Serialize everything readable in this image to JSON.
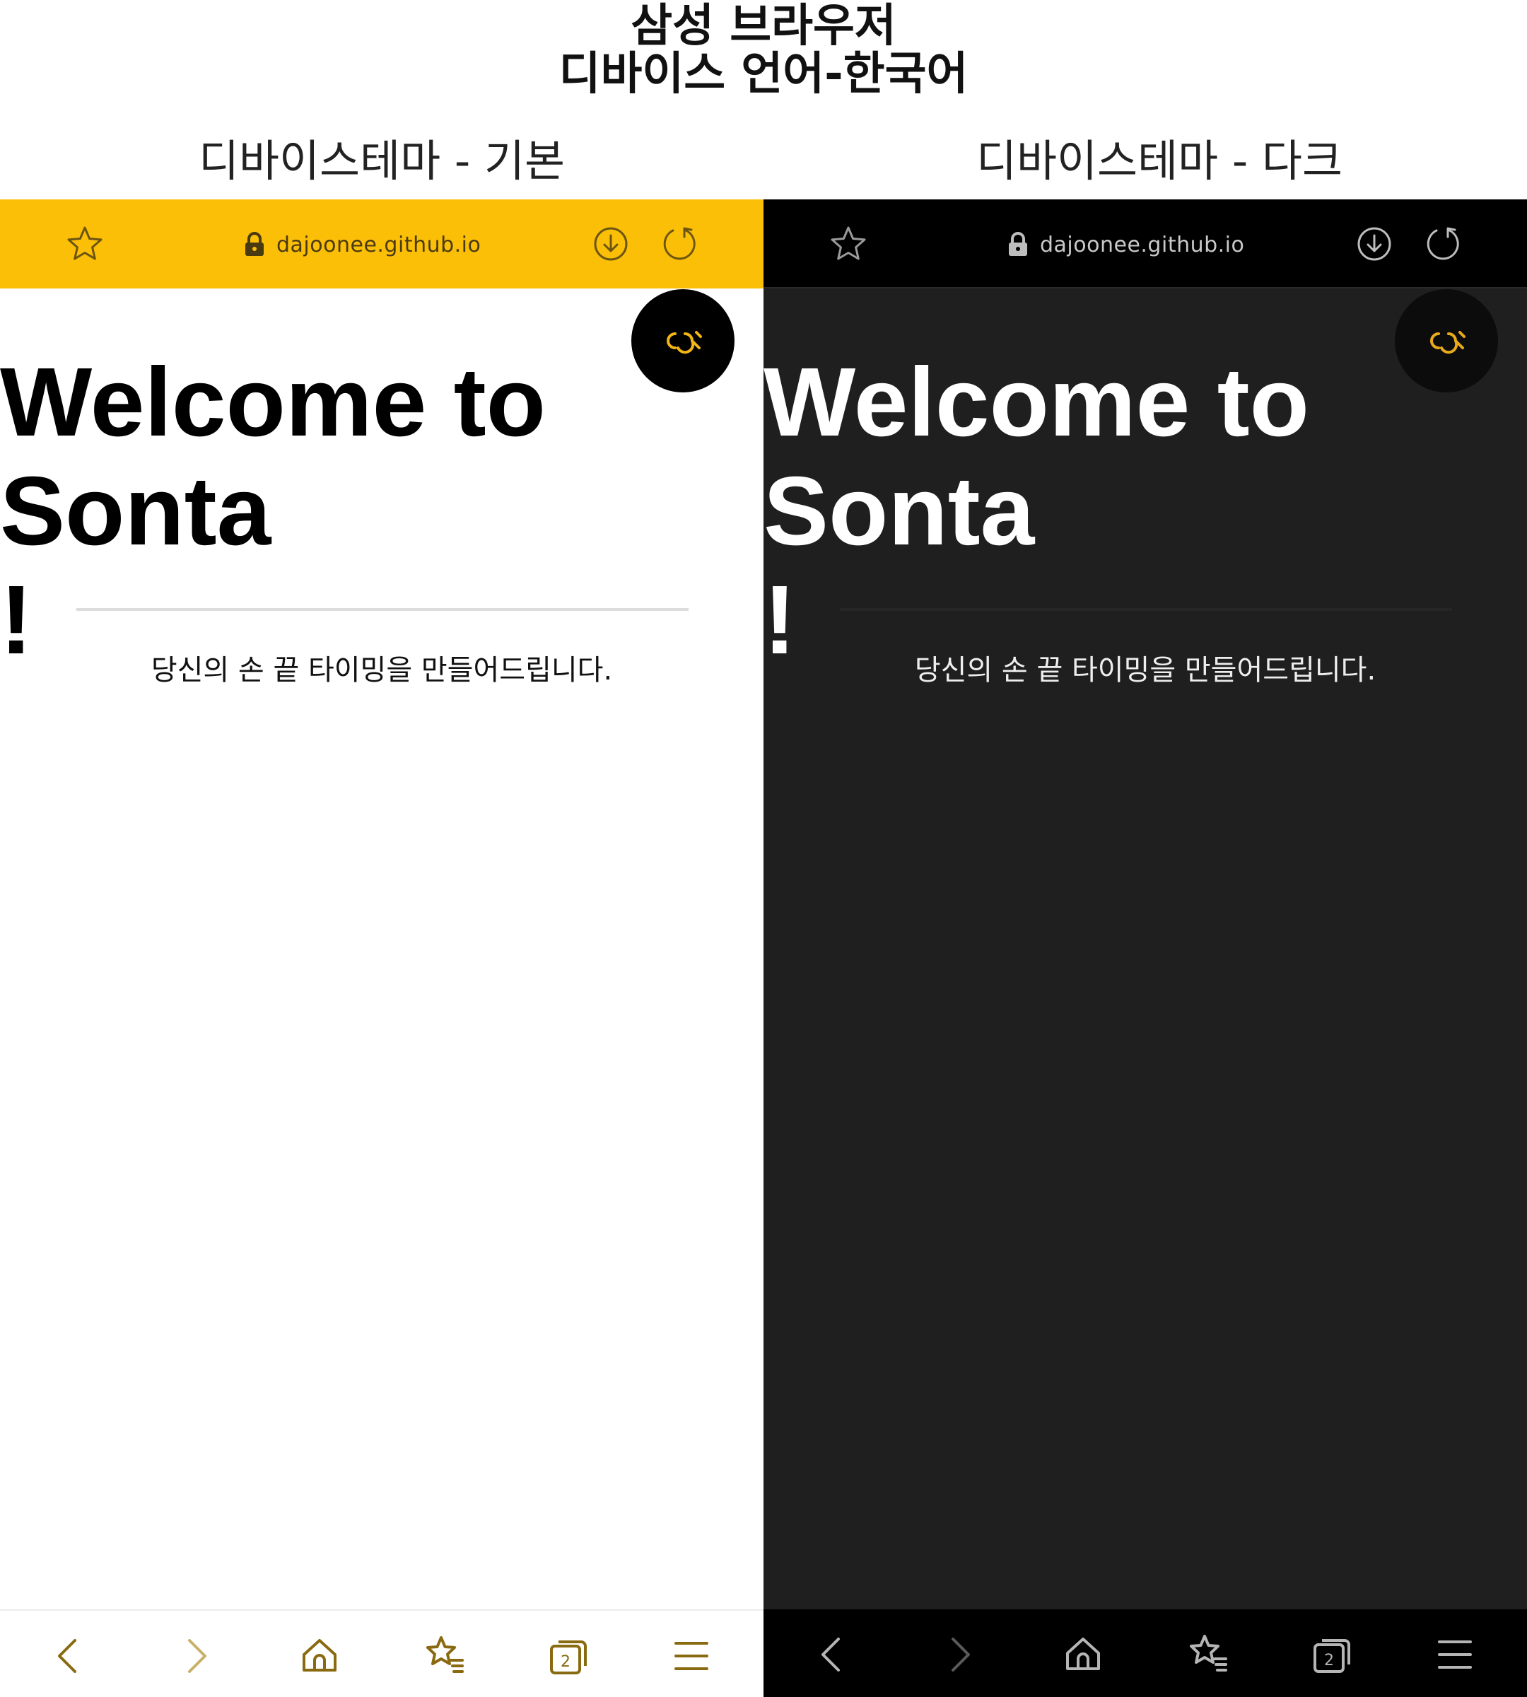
{
  "captions": {
    "title_line1": "삼성 브라우저",
    "title_line2": "디바이스 언어-한국어",
    "left_label": "디바이스테마 - 기본",
    "right_label": "디바이스테마 - 다크"
  },
  "browser": {
    "url": "dajoonee.github.io",
    "tab_count": "2",
    "icons": {
      "bookmark": "star-icon",
      "lock": "lock-icon",
      "download": "download-icon",
      "reload": "reload-icon",
      "back": "chevron-left-icon",
      "forward": "chevron-right-icon",
      "home": "home-icon",
      "bookmarks": "bookmarks-icon",
      "tabs": "tabs-icon",
      "menu": "menu-icon"
    }
  },
  "page": {
    "heading": "Welcome to Sonta\n!",
    "tagline": "당신의 손 끝 타이밍을 만들어드립니다.",
    "logo": "sonta-logo"
  },
  "themes": {
    "light": {
      "toolbar": "#fcbf08",
      "background": "#ffffff",
      "icon": "#8a6a10",
      "text": "#000000"
    },
    "dark": {
      "toolbar": "#000000",
      "background": "#1f1f1f",
      "icon": "#9a9a9a",
      "text": "#ffffff"
    },
    "logo_accent": "#f2b416"
  }
}
